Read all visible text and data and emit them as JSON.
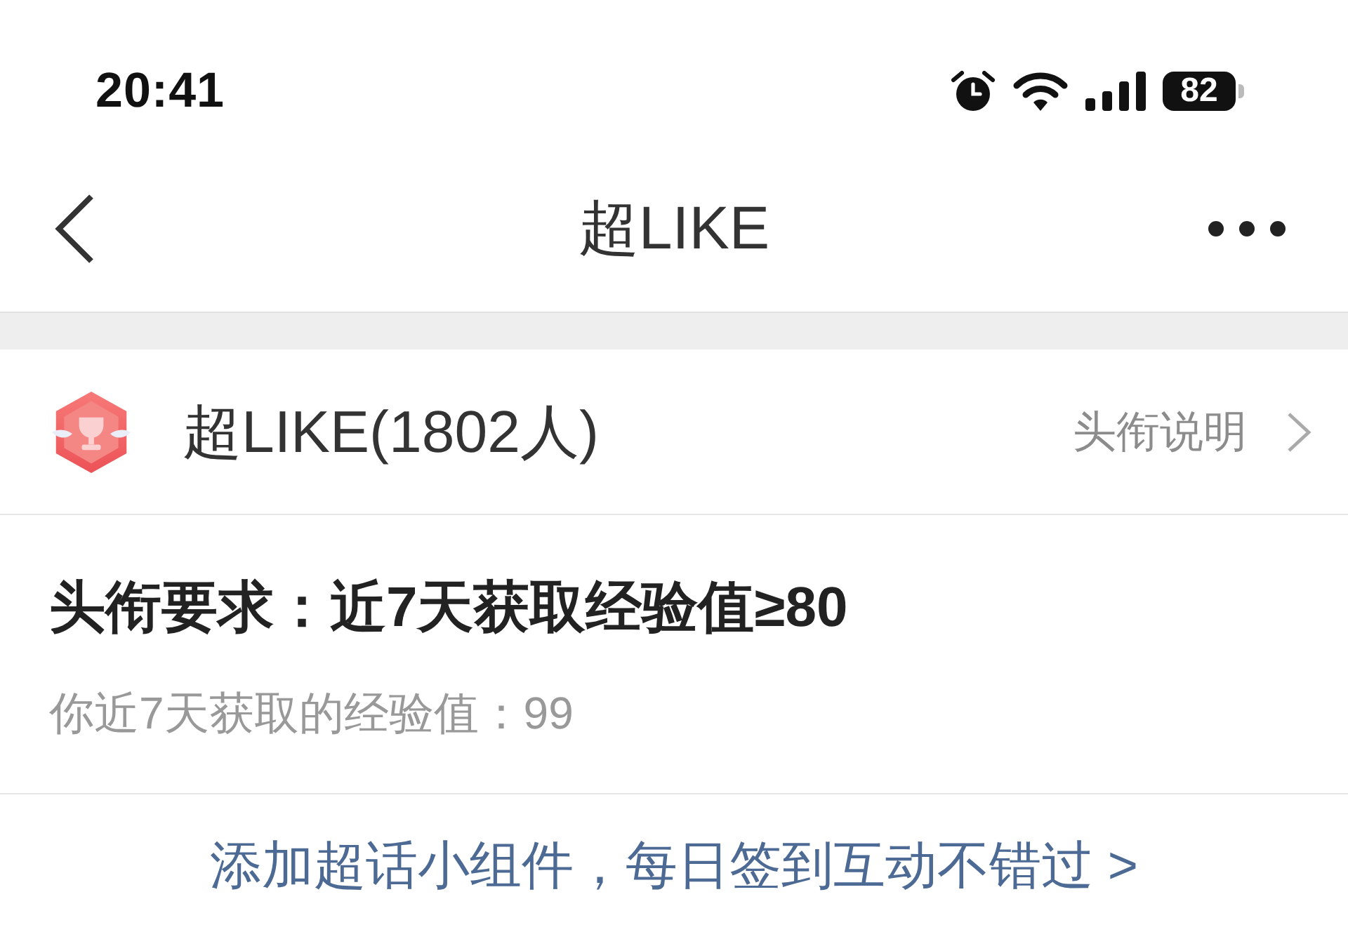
{
  "status_bar": {
    "time": "20:41",
    "battery": "82"
  },
  "nav_bar": {
    "title": "超LIKE"
  },
  "title_row": {
    "name": "超LIKE(1802人)",
    "link": "头衔说明"
  },
  "requirement": {
    "title": "头衔要求：近7天获取经验值≥80",
    "progress": "你近7天获取的经验值：99"
  },
  "footer_link": "添加超话小组件，每日签到互动不错过 >"
}
